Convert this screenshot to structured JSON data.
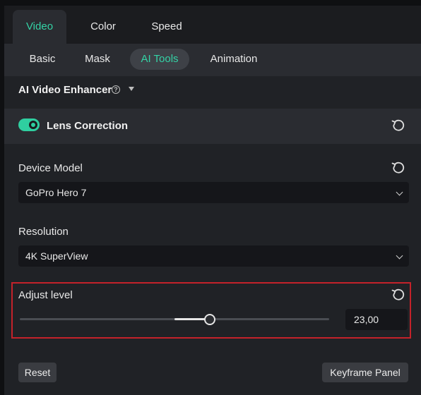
{
  "tabs": {
    "top": [
      "Video",
      "Color",
      "Speed"
    ],
    "active_top": "Video",
    "sub": [
      "Basic",
      "Mask",
      "AI Tools",
      "Animation"
    ],
    "active_sub": "AI Tools"
  },
  "enhancer": {
    "title": "AI Video Enhancer",
    "help_icon": "question-circle-icon",
    "dropdown_icon": "caret-down-icon"
  },
  "lens_correction": {
    "label": "Lens Correction",
    "enabled": true
  },
  "device_model": {
    "label": "Device Model",
    "value": "GoPro Hero 7"
  },
  "resolution": {
    "label": "Resolution",
    "value": "4K SuperView"
  },
  "adjust_level": {
    "label": "Adjust level",
    "value": "23,00",
    "slider_fraction": 0.615,
    "slider_center_fraction": 0.5
  },
  "footer": {
    "reset_label": "Reset",
    "keyframe_label": "Keyframe Panel"
  },
  "colors": {
    "accent": "#34d3a6",
    "highlight_border": "#c4222a"
  }
}
